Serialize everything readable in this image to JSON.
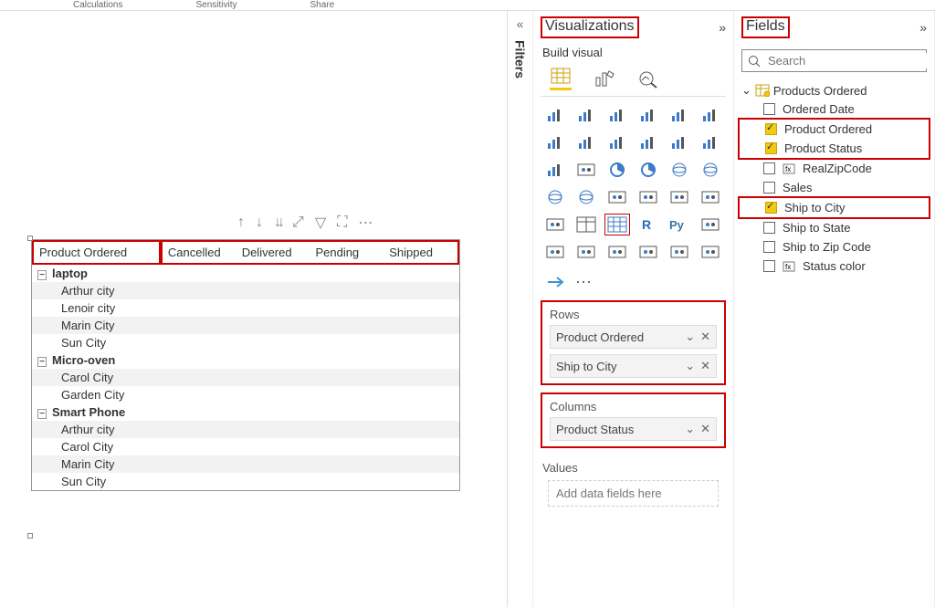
{
  "topbar": {
    "calc": "Calculations",
    "sens": "Sensitivity",
    "share": "Share"
  },
  "filters": {
    "label": "Filters"
  },
  "viz": {
    "title": "Visualizations",
    "sub": "Build visual",
    "icons": [
      [
        "stacked-bar",
        "clustered-bar",
        "stacked-col",
        "clustered-col",
        "stacked-bar-100",
        "clustered-col-line"
      ],
      [
        "line",
        "area",
        "stacked-area",
        "line-col",
        "ribbon",
        "waterfall"
      ],
      [
        "funnel",
        "scatter",
        "pie",
        "donut",
        "treemap",
        "map"
      ],
      [
        "filled-map",
        "azure-map",
        "gauge",
        "card",
        "multi-card",
        "kpi"
      ],
      [
        "slicer",
        "table",
        "matrix",
        "r",
        "py",
        "key-influencer"
      ],
      [
        "decomp",
        "qa",
        "narrative",
        "paginated",
        "power-apps",
        "power-automate"
      ]
    ],
    "selected_icon": "matrix",
    "more": "···",
    "rows_label": "Rows",
    "rows": [
      "Product Ordered",
      "Ship to City"
    ],
    "cols_label": "Columns",
    "cols": [
      "Product Status"
    ],
    "values_label": "Values",
    "values_placeholder": "Add data fields here"
  },
  "fields": {
    "title": "Fields",
    "search_placeholder": "Search",
    "table": "Products Ordered",
    "items": [
      {
        "name": "Ordered Date",
        "checked": false,
        "icon": null
      },
      {
        "name": "Product Ordered",
        "checked": true,
        "icon": null,
        "hl": true
      },
      {
        "name": "Product Status",
        "checked": true,
        "icon": null,
        "hl": true
      },
      {
        "name": "RealZipCode",
        "checked": false,
        "icon": "fx"
      },
      {
        "name": "Sales",
        "checked": false,
        "icon": null
      },
      {
        "name": "Ship to City",
        "checked": true,
        "icon": null,
        "hl": true
      },
      {
        "name": "Ship to State",
        "checked": false,
        "icon": null
      },
      {
        "name": "Ship to Zip Code",
        "checked": false,
        "icon": null
      },
      {
        "name": "Status color",
        "checked": false,
        "icon": "fx"
      }
    ]
  },
  "matrix": {
    "row_header": "Product Ordered",
    "col_headers": [
      "Cancelled",
      "Delivered",
      "Pending",
      "Shipped"
    ],
    "groups": [
      {
        "name": "laptop",
        "children": [
          "Arthur city",
          "Lenoir city",
          "Marin City",
          "Sun City"
        ]
      },
      {
        "name": "Micro-oven",
        "children": [
          "Carol City",
          "Garden City"
        ]
      },
      {
        "name": "Smart Phone",
        "children": [
          "Arthur city",
          "Carol City",
          "Marin City",
          "Sun City"
        ]
      }
    ]
  }
}
